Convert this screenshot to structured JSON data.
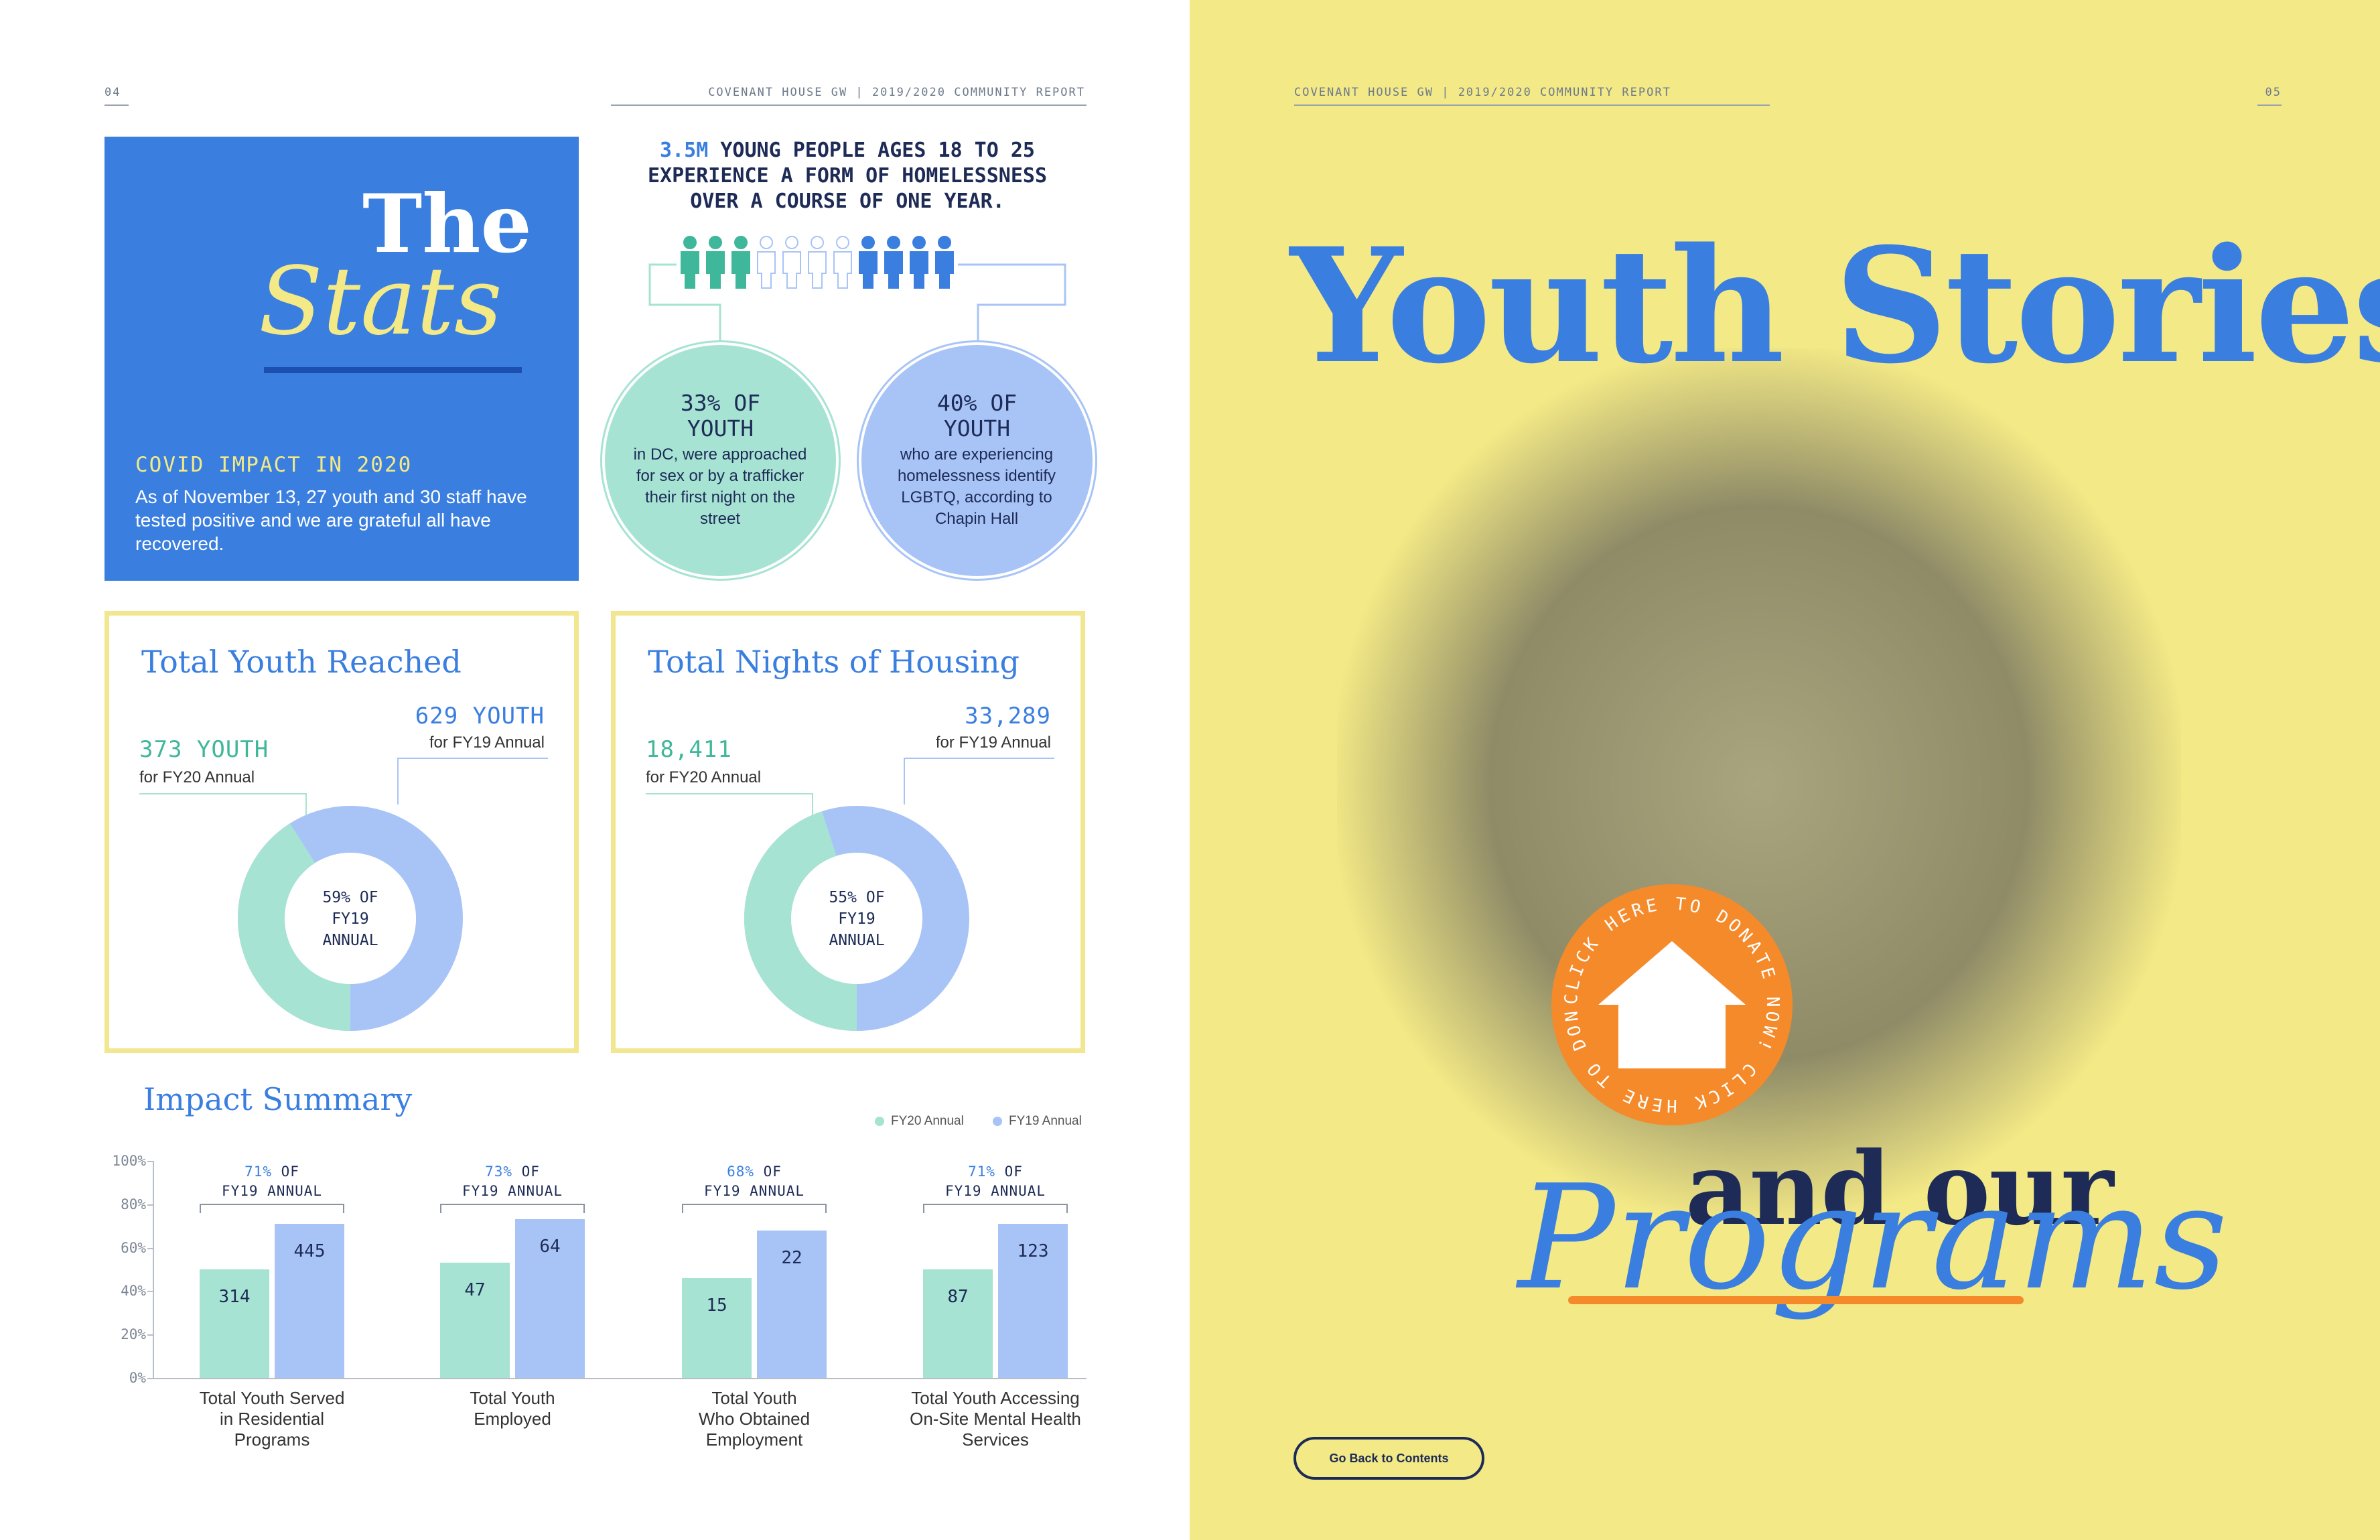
{
  "left_page": {
    "page_number": "04",
    "running_head": "COVENANT HOUSE GW  |  2019/2020 COMMUNITY REPORT",
    "stats_box": {
      "title_word_1": "The",
      "title_word_2": "Stats",
      "covid_heading": "COVID IMPACT IN 2020",
      "covid_text": "As of November 13, 27 youth and 30 staff have tested positive and we are grateful all have recovered."
    },
    "headline": {
      "highlight": "3.5M",
      "line1_rest": " YOUNG PEOPLE AGES 18 TO 25",
      "line2": "EXPERIENCE A FORM OF HOMELESSNESS",
      "line3": "OVER A COURSE OF ONE YEAR."
    },
    "people_icons": {
      "green": 3,
      "outline": 4,
      "blue": 4
    },
    "circle_left": {
      "heading1": "33% OF",
      "heading2": "YOUTH",
      "body": "in DC, were approached for sex or by a trafficker their first night on the street"
    },
    "circle_right": {
      "heading1": "40% OF",
      "heading2": "YOUTH",
      "body": "who are experiencing homelessness identify LGBTQ, according to Chapin Hall"
    },
    "youth_reached": {
      "title": "Total Youth Reached",
      "fy19_value": "629 YOUTH",
      "fy19_label": "for FY19 Annual",
      "fy20_value": "373 YOUTH",
      "fy20_label": "for FY20 Annual",
      "center_line1": "59% OF",
      "center_line2": "FY19",
      "center_line3": "ANNUAL",
      "fy20_share": 0.41
    },
    "nights_housing": {
      "title": "Total Nights of Housing",
      "fy19_value": "33,289",
      "fy19_label": "for FY19 Annual",
      "fy20_value": "18,411",
      "fy20_label": "for FY20 Annual",
      "center_line1": "55% OF",
      "center_line2": "FY19",
      "center_line3": "ANNUAL",
      "fy20_share": 0.45
    },
    "impact": {
      "title": "Impact Summary",
      "legend_fy20": "FY20 Annual",
      "legend_fy19": "FY19 Annual"
    }
  },
  "right_page": {
    "running_head": "COVENANT HOUSE GW  |  2019/2020 COMMUNITY REPORT",
    "page_number": "05",
    "title": "Youth Stories",
    "subtitle_1": "and our",
    "subtitle_2": "Programs",
    "donate_ring_text": "CLICK HERE TO DONATE NOW!  CLICK HERE TO DONATE NOW!",
    "back_button": "Go Back to Contents"
  },
  "colors": {
    "blue": "#3a7fe0",
    "navy": "#1d2b56",
    "mint": "#a6e3d3",
    "light_blue": "#a8c4f7",
    "yellow_page": "#f3e986",
    "box_border": "#f2e790",
    "orange": "#f58a2a",
    "green_text": "#3fb79a"
  },
  "chart_data": {
    "type": "bar",
    "title": "Impact Summary",
    "categories": [
      "Total Youth Served in Residential Programs",
      "Total Youth Employed",
      "Total Youth Who Obtained Employment",
      "Total Youth Accessing On-Site Mental Health Services"
    ],
    "category_lines": [
      [
        "Total Youth Served",
        "in Residential",
        "Programs"
      ],
      [
        "Total Youth",
        "Employed"
      ],
      [
        "Total Youth",
        "Who Obtained",
        "Employment"
      ],
      [
        "Total Youth Accessing",
        "On-Site Mental Health",
        "Services"
      ]
    ],
    "series": [
      {
        "name": "FY20 Annual",
        "values": [
          314,
          47,
          15,
          87
        ],
        "heights_pct": [
          50,
          53,
          46,
          50
        ]
      },
      {
        "name": "FY19 Annual",
        "values": [
          445,
          64,
          22,
          123
        ],
        "heights_pct": [
          71,
          73,
          68,
          71
        ]
      }
    ],
    "pct_labels": [
      "71% OF",
      "73% OF",
      "68% OF",
      "71% OF"
    ],
    "pct_sub": [
      "FY19 ANNUAL",
      "FY19 ANNUAL",
      "FY19 ANNUAL",
      "FY19 ANNUAL"
    ],
    "yticks": [
      "100%",
      "80%",
      "60%",
      "40%",
      "20%",
      "0%"
    ],
    "ylim": [
      0,
      100
    ],
    "legend": "top-right",
    "grid": false
  }
}
